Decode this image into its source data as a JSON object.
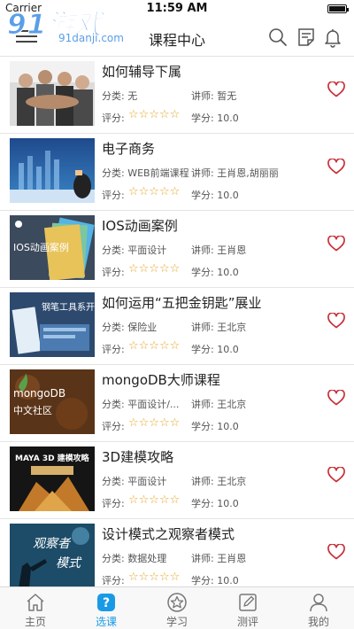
{
  "status_bar": {
    "carrier": "Carrier",
    "time": "11:59 AM"
  },
  "watermark": {
    "main": "91游戏",
    "sub": "91danji.com"
  },
  "nav": {
    "title": "课程中心"
  },
  "labels": {
    "category": "分类:",
    "teacher": "讲师:",
    "rating": "评分:",
    "credit": "学分:"
  },
  "courses": [
    {
      "title": "如何辅导下属",
      "category": "无",
      "teacher": "暂无",
      "rating_stars": "☆☆☆☆☆",
      "rating": 0,
      "credit": "10.0"
    },
    {
      "title": "电子商务",
      "category": "WEB前端课程",
      "teacher": "王肖恩,胡丽丽",
      "rating_stars": "☆☆☆☆☆",
      "rating": 0,
      "credit": "10.0"
    },
    {
      "title": "IOS动画案例",
      "category": "平面设计",
      "teacher": "王肖恩",
      "rating_stars": "☆☆☆☆☆",
      "rating": 0,
      "credit": "10.0",
      "thumb_text": "IOS动画案例"
    },
    {
      "title": "如何运用“五把金钥匙”展业",
      "category": "保险业",
      "teacher": "王北京",
      "rating_stars": "☆☆☆☆☆",
      "rating": 0,
      "credit": "10.0",
      "thumb_text": "钢笔工具系开发"
    },
    {
      "title": "mongoDB大师课程",
      "category": "平面设计/...",
      "teacher": "王北京",
      "rating_stars": "☆☆☆☆☆",
      "rating": 0,
      "credit": "10.0",
      "thumb_text": "mongoDB",
      "thumb_text2": "中文社区"
    },
    {
      "title": "3D建模攻略",
      "category": "平面设计",
      "teacher": "王北京",
      "rating_stars": "☆☆☆☆☆",
      "rating": 0,
      "credit": "10.0",
      "thumb_text": "MAYA 3D 建模攻略"
    },
    {
      "title": "设计模式之观察者模式",
      "category": "数据处理",
      "teacher": "王肖恩",
      "rating_stars": "☆☆☆☆☆",
      "rating": 0,
      "credit": "10.0",
      "thumb_text": "观察者",
      "thumb_text2": "模式"
    }
  ],
  "tabs": [
    {
      "label": "主页",
      "icon": "home-icon",
      "active": false
    },
    {
      "label": "选课",
      "icon": "question-badge-icon",
      "active": true
    },
    {
      "label": "学习",
      "icon": "star-circle-icon",
      "active": false
    },
    {
      "label": "测评",
      "icon": "edit-icon",
      "active": false
    },
    {
      "label": "我的",
      "icon": "person-icon",
      "active": false
    }
  ],
  "colors": {
    "accent": "#1a9ae6",
    "favorite": "#c8323a",
    "star": "#e3a627",
    "watermark": "#5b9ee8"
  }
}
